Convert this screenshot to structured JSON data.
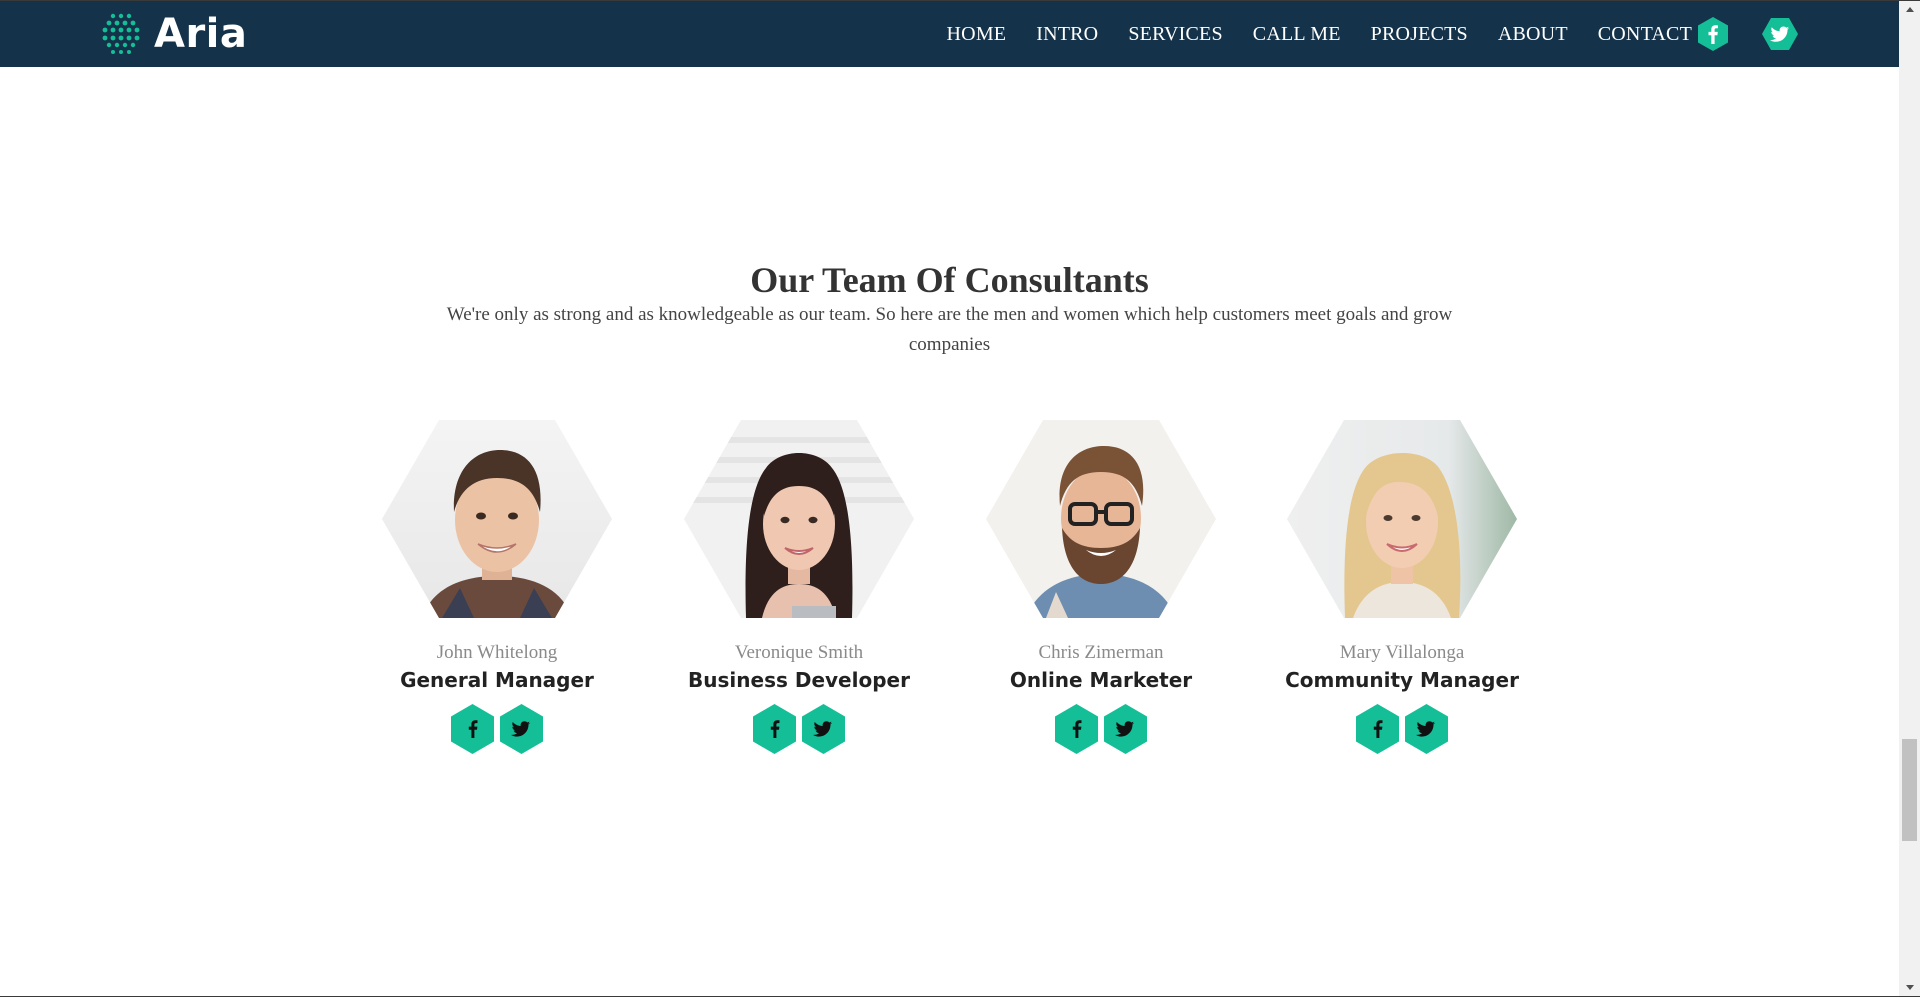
{
  "brand": {
    "name": "Aria",
    "accent": "#14bf98",
    "nav_bg": "#14334a"
  },
  "nav": {
    "links": [
      "HOME",
      "INTRO",
      "SERVICES",
      "CALL ME",
      "PROJECTS",
      "ABOUT",
      "CONTACT"
    ],
    "social": [
      "facebook-icon",
      "twitter-icon"
    ]
  },
  "team": {
    "title": "Our Team Of Consultants",
    "intro": "We're only as strong and as knowledgeable as our team. So here are the men and women which help customers meet goals and grow companies",
    "members": [
      {
        "name": "John Whitelong",
        "role": "General Manager",
        "social": [
          "facebook-icon",
          "twitter-icon"
        ]
      },
      {
        "name": "Veronique Smith",
        "role": "Business Developer",
        "social": [
          "facebook-icon",
          "twitter-icon"
        ]
      },
      {
        "name": "Chris Zimerman",
        "role": "Online Marketer",
        "social": [
          "facebook-icon",
          "twitter-icon"
        ]
      },
      {
        "name": "Mary Villalonga",
        "role": "Community Manager",
        "social": [
          "facebook-icon",
          "twitter-icon"
        ]
      }
    ]
  }
}
